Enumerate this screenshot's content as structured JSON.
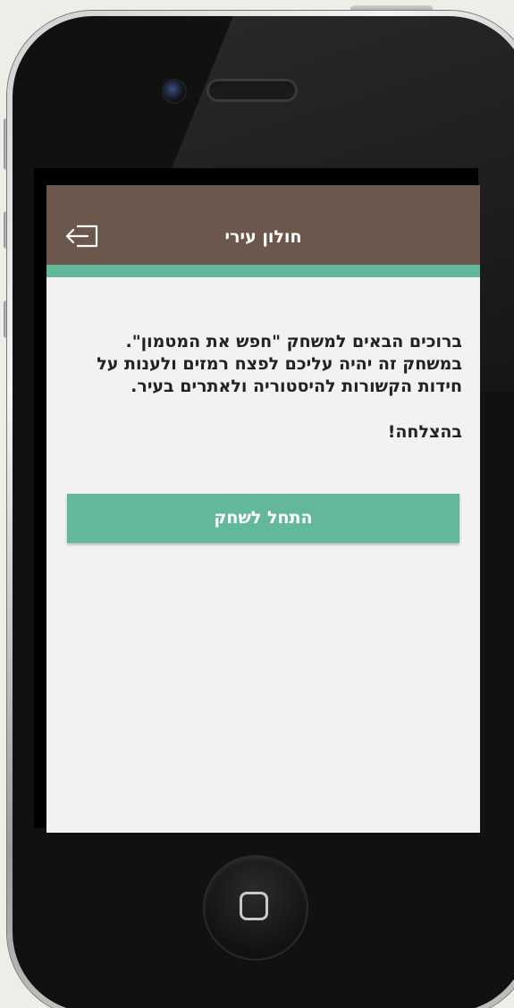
{
  "app": {
    "header": {
      "title": "חולון עירי",
      "exit_icon": "exit-icon"
    },
    "welcome": {
      "lines": [
        "ברוכים הבאים למשחק \"חפש את המטמון\".",
        "במשחק זה יהיה עליכם לפצח רמזים ולענות על",
        "חידות הקשורות להיסטוריה ולאתרים בעיר."
      ],
      "good_luck": "בהצלחה!"
    },
    "start_button": {
      "label": "התחל לשחק"
    }
  },
  "colors": {
    "header_bg": "#6b574c",
    "accent": "#63b89a",
    "screen_bg": "#f2f2f2",
    "text": "#222222"
  }
}
